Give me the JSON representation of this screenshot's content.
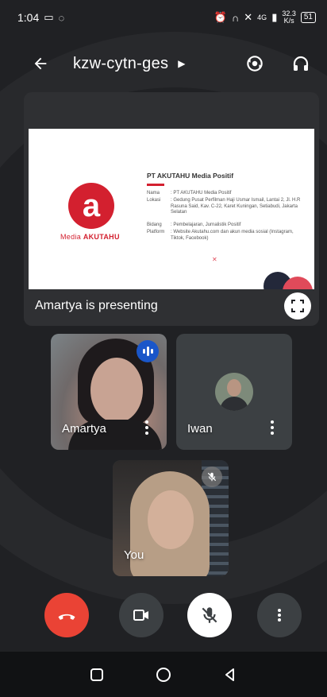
{
  "status_bar": {
    "time": "1:04",
    "signal_label": "4G",
    "net_speed": "32.3",
    "net_unit": "K/s",
    "battery": "51"
  },
  "app_bar": {
    "meeting_code": "kzw-cytn-ges"
  },
  "presentation": {
    "caption": "Amartya is presenting",
    "slide": {
      "logo_letter": "a",
      "logo_brand_prefix": "Media",
      "logo_brand_name": "AKUTAHU",
      "title": "PT AKUTAHU Media Positif",
      "rows": [
        {
          "key": "Nama",
          "value": ": PT AKUTAHU Media Positif"
        },
        {
          "key": "Lokasi",
          "value": ": Gedung Pusat Perfilman Haji Usmar Ismail, Lantai 2, Jl. H.R Rasuna Said, Kav. C-22, Karet Kuningan, Setiabudi, Jakarta Selatan"
        },
        {
          "key": "Bidang",
          "value": ": Pembelajaran, Jurnalistik Positif"
        },
        {
          "key": "Platform",
          "value": ": Website Akutahu.com dan akun media sosial (Instagram, Tiktok, Facebook)"
        }
      ]
    }
  },
  "participants": [
    {
      "name": "Amartya",
      "state": "speaking"
    },
    {
      "name": "Iwan",
      "state": "camera-off"
    },
    {
      "name": "You",
      "state": "muted"
    }
  ],
  "icons": {
    "back": "arrow-left-icon",
    "switch_camera": "switch-camera-icon",
    "audio": "headphones-icon",
    "fullscreen": "fullscreen-icon",
    "end_call": "end-call-icon",
    "camera": "camera-icon",
    "mic": "mic-off-icon",
    "more": "more-vert-icon"
  },
  "colors": {
    "end_call": "#ea4335",
    "speaking": "#1a56c9",
    "brand": "#d3202f"
  }
}
